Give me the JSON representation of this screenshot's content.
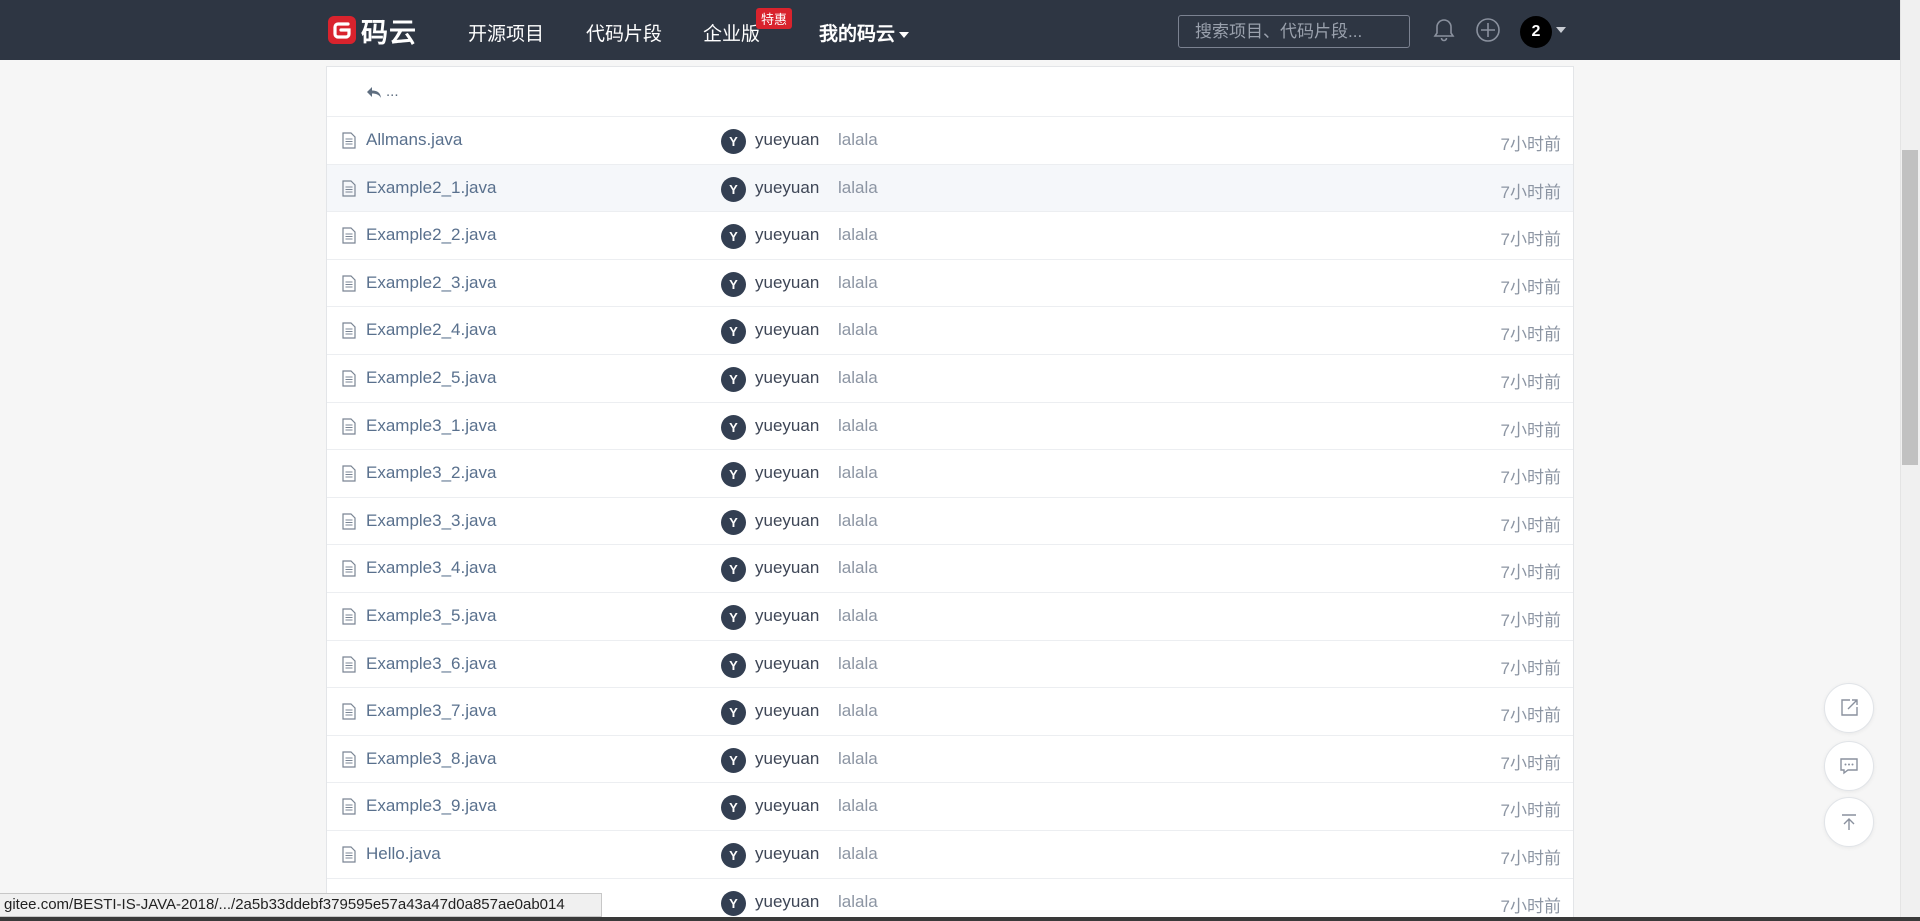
{
  "header": {
    "logo_text": "码云",
    "nav": {
      "open_source": "开源项目",
      "snippets": "代码片段",
      "enterprise": "企业版",
      "enterprise_badge": "特惠",
      "my_gitee": "我的码云"
    },
    "search_placeholder": "搜索项目、代码片段...",
    "user_avatar_text": "2",
    "colors": {
      "bar": "#2e3643",
      "logo_red": "#d9232d"
    }
  },
  "file_list": {
    "back_label": "...",
    "rows": [
      {
        "name": "Allmans.java",
        "avatar": "Y",
        "author": "yueyuan",
        "message": "lalala",
        "time": "7小时前"
      },
      {
        "name": "Example2_1.java",
        "avatar": "Y",
        "author": "yueyuan",
        "message": "lalala",
        "time": "7小时前"
      },
      {
        "name": "Example2_2.java",
        "avatar": "Y",
        "author": "yueyuan",
        "message": "lalala",
        "time": "7小时前"
      },
      {
        "name": "Example2_3.java",
        "avatar": "Y",
        "author": "yueyuan",
        "message": "lalala",
        "time": "7小时前"
      },
      {
        "name": "Example2_4.java",
        "avatar": "Y",
        "author": "yueyuan",
        "message": "lalala",
        "time": "7小时前"
      },
      {
        "name": "Example2_5.java",
        "avatar": "Y",
        "author": "yueyuan",
        "message": "lalala",
        "time": "7小时前"
      },
      {
        "name": "Example3_1.java",
        "avatar": "Y",
        "author": "yueyuan",
        "message": "lalala",
        "time": "7小时前"
      },
      {
        "name": "Example3_2.java",
        "avatar": "Y",
        "author": "yueyuan",
        "message": "lalala",
        "time": "7小时前"
      },
      {
        "name": "Example3_3.java",
        "avatar": "Y",
        "author": "yueyuan",
        "message": "lalala",
        "time": "7小时前"
      },
      {
        "name": "Example3_4.java",
        "avatar": "Y",
        "author": "yueyuan",
        "message": "lalala",
        "time": "7小时前"
      },
      {
        "name": "Example3_5.java",
        "avatar": "Y",
        "author": "yueyuan",
        "message": "lalala",
        "time": "7小时前"
      },
      {
        "name": "Example3_6.java",
        "avatar": "Y",
        "author": "yueyuan",
        "message": "lalala",
        "time": "7小时前"
      },
      {
        "name": "Example3_7.java",
        "avatar": "Y",
        "author": "yueyuan",
        "message": "lalala",
        "time": "7小时前"
      },
      {
        "name": "Example3_8.java",
        "avatar": "Y",
        "author": "yueyuan",
        "message": "lalala",
        "time": "7小时前"
      },
      {
        "name": "Example3_9.java",
        "avatar": "Y",
        "author": "yueyuan",
        "message": "lalala",
        "time": "7小时前"
      },
      {
        "name": "Hello.java",
        "avatar": "Y",
        "author": "yueyuan",
        "message": "lalala",
        "time": "7小时前"
      },
      {
        "name": "",
        "avatar": "Y",
        "author": "yueyuan",
        "message": "lalala",
        "time": "7小时前"
      }
    ]
  },
  "floating": {
    "icons": [
      "share-icon",
      "comment-icon",
      "back-to-top-icon"
    ]
  },
  "status_bar": {
    "url": "gitee.com/BESTI-IS-JAVA-2018/.../2a5b33ddebf379595e57a43a47d0a857ae0ab014"
  }
}
